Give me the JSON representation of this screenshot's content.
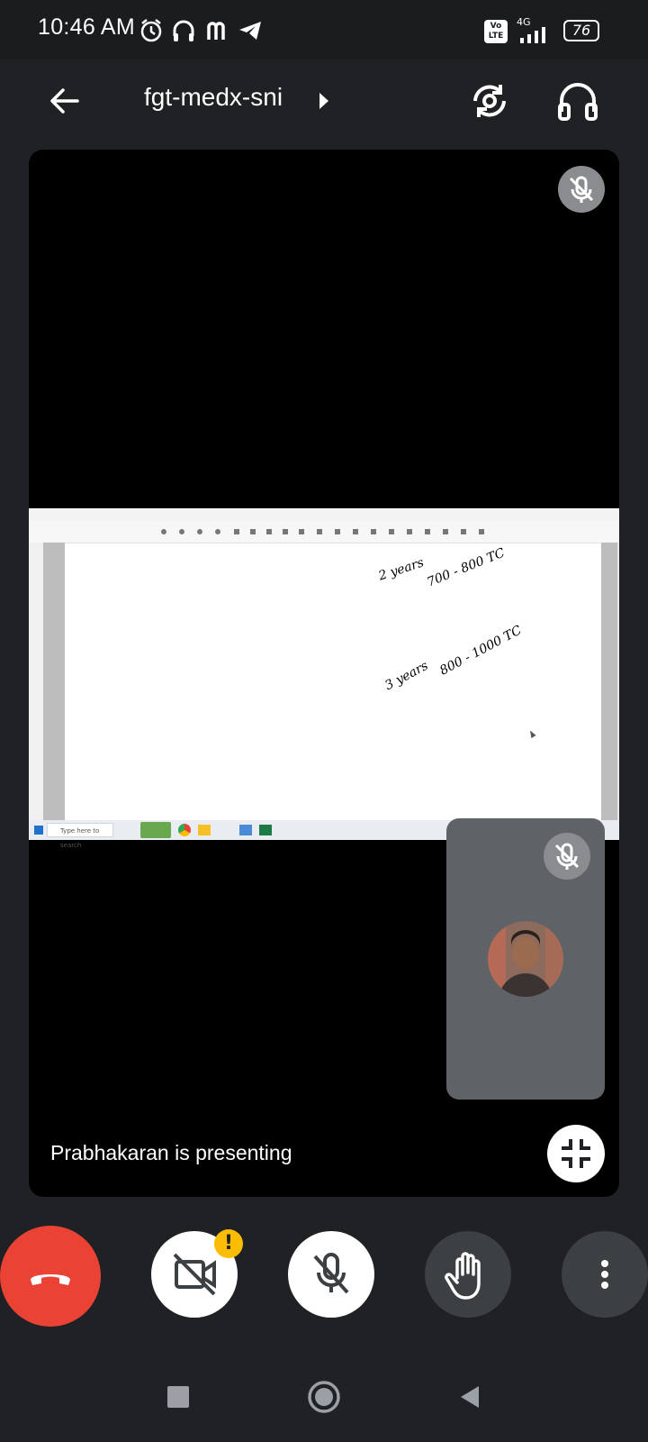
{
  "status_bar": {
    "time": "10:46 AM",
    "network": "4G",
    "volte": "Vo LTE",
    "battery": "76",
    "icons": [
      "alarm-icon",
      "headphones-icon",
      "m-icon",
      "telegram-icon"
    ]
  },
  "header": {
    "title": "fgt-medx-sni",
    "back_icon": "arrow-left-icon",
    "switch_camera_icon": "switch-camera-icon",
    "audio_output_icon": "headphones-icon"
  },
  "shared_screen": {
    "taskbar_search_placeholder": "Type here to search",
    "notes": [
      {
        "label": "2 years",
        "value": "700 - 800 TC"
      },
      {
        "label": "3 years",
        "value": "800 - 1000 TC"
      }
    ]
  },
  "stage": {
    "presenting_text": "Prabhakaran is presenting"
  },
  "controls": {
    "end_call_icon": "phone-hangup-icon",
    "camera_icon": "camera-off-icon",
    "camera_warning": "!",
    "mic_icon": "mic-off-icon",
    "raise_hand_icon": "hand-icon",
    "more_icon": "more-vertical-icon",
    "colors": {
      "end_call": "#ea4335",
      "warning": "#fbbc04",
      "tile": "#5f6368"
    }
  },
  "nav_bar": {
    "items": [
      "recents-square-icon",
      "home-circle-icon",
      "back-triangle-icon"
    ]
  }
}
